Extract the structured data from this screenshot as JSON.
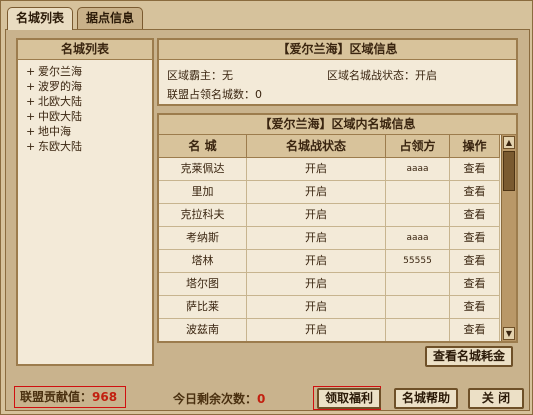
{
  "tabs": [
    {
      "label": "名城列表",
      "active": true
    },
    {
      "label": "据点信息",
      "active": false
    }
  ],
  "left_panel": {
    "title": "名城列表",
    "regions": [
      "爱尔兰海",
      "波罗的海",
      "北欧大陆",
      "中欧大陆",
      "地中海",
      "东欧大陆"
    ]
  },
  "info_panel": {
    "title": "【爱尔兰海】区域信息",
    "overlord_label": "区域霸主：无",
    "war_status_label": "区域名城战状态：开启",
    "alliance_count_label": "联盟占领名城数：0"
  },
  "city_table": {
    "title": "【爱尔兰海】区域内名城信息",
    "columns": [
      "名 城",
      "名城战状态",
      "占领方",
      "操作"
    ],
    "rows": [
      {
        "city": "克莱佩达",
        "status": "开启",
        "owner": "aaaa",
        "action": "查看"
      },
      {
        "city": "里加",
        "status": "开启",
        "owner": "",
        "action": "查看"
      },
      {
        "city": "克拉科夫",
        "status": "开启",
        "owner": "",
        "action": "查看"
      },
      {
        "city": "考纳斯",
        "status": "开启",
        "owner": "aaaa",
        "action": "查看"
      },
      {
        "city": "塔林",
        "status": "开启",
        "owner": "55555",
        "action": "查看"
      },
      {
        "city": "塔尔图",
        "status": "开启",
        "owner": "",
        "action": "查看"
      },
      {
        "city": "萨比莱",
        "status": "开启",
        "owner": "",
        "action": "查看"
      },
      {
        "city": "波兹南",
        "status": "开启",
        "owner": "",
        "action": "查看"
      }
    ]
  },
  "buttons": {
    "view_cost": "查看名城耗金",
    "claim_welfare": "领取福利",
    "city_help": "名城帮助",
    "close": "关 闭"
  },
  "footer": {
    "contribution_label": "联盟贡献值：",
    "contribution_value": "968",
    "remaining_label": "今日剩余次数：",
    "remaining_value": "0"
  },
  "colors": {
    "highlight_box": "#d01010",
    "value_text": "#c21f0f",
    "panel_bg": "#f3ead8",
    "frame_bg": "#d6c29c"
  }
}
